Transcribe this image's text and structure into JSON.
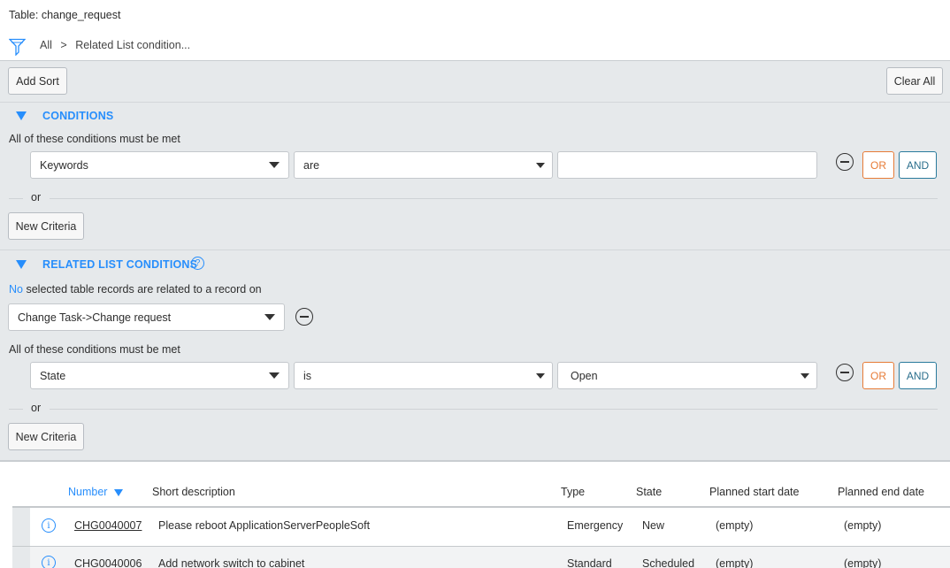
{
  "header": {
    "table_label": "Table: change_request",
    "breadcrumb_all": "All",
    "breadcrumb_sep": ">",
    "breadcrumb_current": "Related List condition..."
  },
  "toolbar": {
    "add_sort": "Add Sort",
    "clear_all": "Clear All"
  },
  "conditions": {
    "title": "CONDITIONS",
    "must_be_met": "All of these conditions must be met",
    "field": "Keywords",
    "operator": "are",
    "value": "",
    "or_label": "OR",
    "and_label": "AND",
    "or_separator": "or",
    "new_criteria": "New Criteria"
  },
  "related": {
    "title": "RELATED LIST CONDITIONS",
    "help_icon": "?",
    "quantity": "No",
    "related_text": "selected table records are related to a record on",
    "relation": "Change Task->Change request",
    "must_be_met": "All of these conditions must be met",
    "field": "State",
    "operator": "is",
    "value": "Open",
    "or_label": "OR",
    "and_label": "AND",
    "or_separator": "or",
    "new_criteria": "New Criteria"
  },
  "table": {
    "columns": {
      "number": "Number",
      "short_description": "Short description",
      "type": "Type",
      "state": "State",
      "planned_start": "Planned start date",
      "planned_end": "Planned end date"
    },
    "rows": [
      {
        "number": "CHG0040007",
        "short_description": "Please reboot ApplicationServerPeopleSoft",
        "type": "Emergency",
        "state": "New",
        "planned_start": "(empty)",
        "planned_end": "(empty)"
      },
      {
        "number": "CHG0040006",
        "short_description": "Add network switch to cabinet",
        "type": "Standard",
        "state": "Scheduled",
        "planned_start": "(empty)",
        "planned_end": "(empty)"
      }
    ]
  },
  "colors": {
    "accent_blue": "#278efc",
    "or_orange": "#e77b36",
    "and_teal": "#2a7a9c",
    "panel_bg": "#e6e9eb"
  }
}
